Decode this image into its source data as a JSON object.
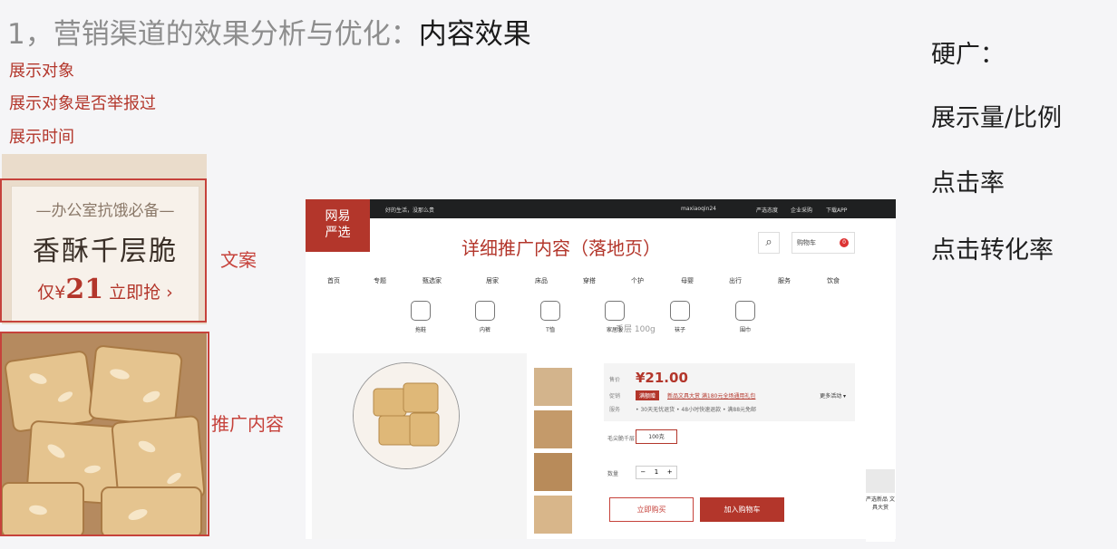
{
  "slide": {
    "title_prefix": "1，营销渠道的效果分析与优化：",
    "title_accent": "内容效果",
    "notes": [
      "展示对象",
      "展示对象是否举报过",
      "展示时间"
    ],
    "labels": {
      "copy": "文案",
      "promo_content": "推广内容"
    },
    "metrics": [
      "硬广：",
      "展示量/比例",
      "点击率",
      "点击转化率"
    ]
  },
  "banner": {
    "tagline": "—办公室抗饿必备—",
    "product": "香酥千层脆",
    "price_prefix": "仅¥",
    "price_value": "21",
    "price_suffix": "立即抢 ›"
  },
  "webpage": {
    "logo_line1": "网易",
    "logo_line2": "严选",
    "slogan": "好的生活，没那么贵",
    "user": "maxiaoqin24",
    "top_links": [
      "严选态度",
      "企业采购",
      "下载APP"
    ],
    "landing_label": "详细推广内容（落地页）",
    "search_icon": "⌕",
    "cart_label": "购物车",
    "cart_count": "0",
    "nav": [
      "首页",
      "专题",
      "甄选家",
      "居家",
      "床品",
      "穿搭",
      "个护",
      "母婴",
      "出行",
      "服务",
      "饮食"
    ],
    "categories": [
      "拖鞋",
      "内裤",
      "T恤",
      "家居服",
      "袜子",
      "围巾"
    ],
    "product_heading": "千层 100g",
    "price_label": "售价",
    "price": "¥21.00",
    "promo_label": "促销",
    "promo_tag": "满额赠",
    "promo_text": "新品文具大赏 满180元全场通用礼包",
    "more_promo": "更多活动 ▾",
    "service_label": "服务",
    "services": "• 30天无忧退货  • 48小时快速退款  • 满88元免邮",
    "spec_label": "毛尖脆千层",
    "spec_option": "100克",
    "qty_label": "数量",
    "qty_minus": "−",
    "qty_value": "1",
    "qty_plus": "+",
    "buy_now": "立即购买",
    "add_to_cart": "加入购物车",
    "side_ad": "严选新品 文具大赏"
  }
}
